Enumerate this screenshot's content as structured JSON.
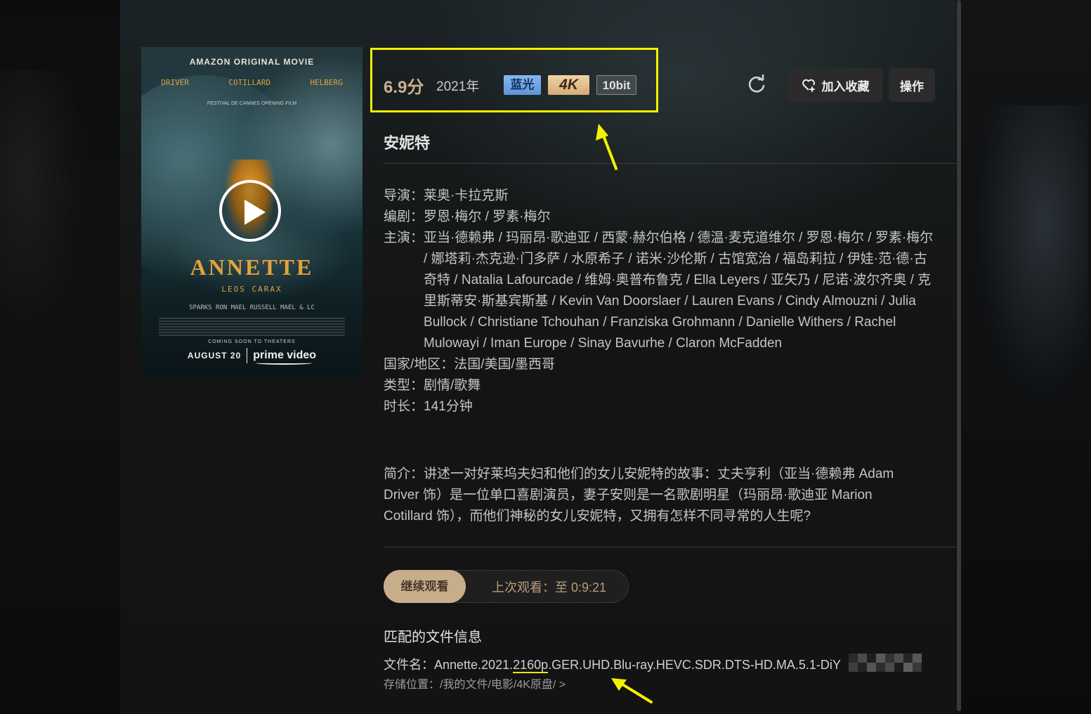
{
  "poster": {
    "top_text": "AMAZON ORIGINAL MOVIE",
    "actors": [
      "DRIVER",
      "COTILLARD",
      "HELBERG"
    ],
    "festival": "FESTIVAL DE CANNES OPENING FILM",
    "title": "ANNETTE",
    "director": "LEOS CARAX",
    "credits": "SPARKS RON MAEL RUSSELL MAEL & LC",
    "coming": "COMING SOON TO THEATERS",
    "date": "AUGUST 20",
    "brand": "prime video"
  },
  "header": {
    "rating": "6.9分",
    "year": "2021年",
    "badges": {
      "bluray": "蓝光",
      "res": "4K",
      "bit": "10bit"
    },
    "favorite_label": "加入收藏",
    "ops_label": "操作"
  },
  "title": "安妮特",
  "info": {
    "director_label": "导演：",
    "director": "莱奥·卡拉克斯",
    "writer_label": "编剧：",
    "writer": "罗恩·梅尔 / 罗素·梅尔",
    "cast_label": "主演：",
    "cast": "亚当·德赖弗 / 玛丽昂·歌迪亚 / 西蒙·赫尔伯格 / 德温·麦克道维尔 / 罗恩·梅尔 / 罗素·梅尔 / 娜塔莉·杰克逊·门多萨 / 水原希子 / 诺米·沙伦斯 / 古馆宽治 / 福岛莉拉 / 伊娃·范·德·古奇特 / Natalia Lafourcade / 维姆·奥普布鲁克 / Ella Leyers / 亚矢乃 / 尼诺·波尔齐奥 / 克里斯蒂安·斯基宾斯基 / Kevin Van Doorslaer / Lauren Evans / Cindy Almouzni / Julia Bullock / Christiane Tchouhan / Franziska Grohmann / Danielle Withers / Rachel Mulowayi / Iman Europe / Sinay Bavurhe / Claron McFadden",
    "country_label": "国家/地区：",
    "country": "法国/美国/墨西哥",
    "genre_label": "类型：",
    "genre": "剧情/歌舞",
    "runtime_label": "时长：",
    "runtime": "141分钟"
  },
  "synopsis": "简介：讲述一对好莱坞夫妇和他们的女儿安妮特的故事：丈夫亨利（亚当·德赖弗 Adam Driver 饰）是一位单口喜剧演员，妻子安则是一名歌剧明星（玛丽昂·歌迪亚 Marion Cotillard 饰），而他们神秘的女儿安妮特，又拥有怎样不同寻常的人生呢?",
  "playback": {
    "continue_label": "继续观看",
    "last_watch": "上次观看：至 0:9:21"
  },
  "file": {
    "heading": "匹配的文件信息",
    "name_prefix": "文件名：Annette.2021.",
    "name_highlight": "2160p",
    "name_suffix": ".GER.UHD.Blu-ray.HEVC.SDR.DTS-HD.MA.5.1-DiY",
    "storage": "存储位置：/我的文件/电影/4K原盘/ >"
  },
  "colors": {
    "accent_gold": "#c8ad8b",
    "highlight_yellow": "#f5f000",
    "bluray_badge": "#6fa3e6",
    "k4_badge": "#e2bf8c"
  }
}
